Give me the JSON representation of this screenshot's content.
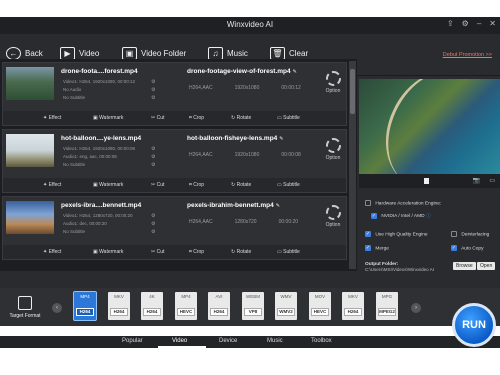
{
  "app": {
    "title": "Winxvideo AI",
    "promo": "Debut Promotion >>"
  },
  "toolbar": {
    "back": "Back",
    "video": "Video",
    "video_folder": "Video Folder",
    "music": "Music",
    "clear": "Clear"
  },
  "items": [
    {
      "src_name": "drone-foota....forest.mp4",
      "src_meta": [
        "Video1: H264, 1920x1080, 00:00:12",
        "No Audio",
        "No Subtitle"
      ],
      "out_name": "drone-footage-view-of-forest.mp4",
      "codec": "H264,AAC",
      "res": "1920x1080",
      "dur": "00:00:12",
      "option": "Option"
    },
    {
      "src_name": "hot-balloon....ye-lens.mp4",
      "src_meta": [
        "Video1: H264, 1920x1080, 00:00:08",
        "Audio1: eng, aac, 00:00:08",
        "No Subtitle"
      ],
      "out_name": "hot-balloon-fisheye-lens.mp4",
      "codec": "H264,AAC",
      "res": "1920x1080",
      "dur": "00:00:08",
      "option": "Option"
    },
    {
      "src_name": "pexels-ibra....bennett.mp4",
      "src_meta": [
        "Video1: H264, 1280x720, 00:00:20",
        "Audio1: dec, 00:00:20",
        "No Subtitle"
      ],
      "out_name": "pexels-ibrahim-bennett.mp4",
      "codec": "H264,AAC",
      "res": "1280x720",
      "dur": "00:00:20",
      "option": "Option"
    }
  ],
  "item_actions": [
    "Effect",
    "Watermark",
    "Cut",
    "Crop",
    "Rotate",
    "Subtitle"
  ],
  "settings": {
    "hw_label": "Hardware Acceleration Engine:",
    "hw_vendor": "NVIDIA / Intel / AMD",
    "high_quality": "Use High Quality Engine",
    "deinterlacing": "Deinterlacing",
    "merge": "Merge",
    "auto_copy": "Auto Copy",
    "output_folder": "Output Folder:",
    "browse": "Browse",
    "open": "Open",
    "path": "C:\\Users\\MSI\\Videos\\Winxvideo AI"
  },
  "target_format": "Target Format",
  "formats": [
    {
      "top": "MP4",
      "bot": "H264",
      "selected": true
    },
    {
      "top": "MKV",
      "bot": "H264"
    },
    {
      "top": "4K",
      "bot": "H264"
    },
    {
      "top": "MP4",
      "bot": "HEVC"
    },
    {
      "top": "AVI",
      "bot": "H264"
    },
    {
      "top": "WEBM",
      "bot": "VP8"
    },
    {
      "top": "WMV",
      "bot": "WMV2"
    },
    {
      "top": "MOV",
      "bot": "HEVC"
    },
    {
      "top": "MKV",
      "bot": "H264"
    },
    {
      "top": "MPG",
      "bot": "MPEG2"
    }
  ],
  "tabs": [
    "Popular",
    "Video",
    "Device",
    "Music",
    "Toolbox"
  ],
  "run": "RUN"
}
